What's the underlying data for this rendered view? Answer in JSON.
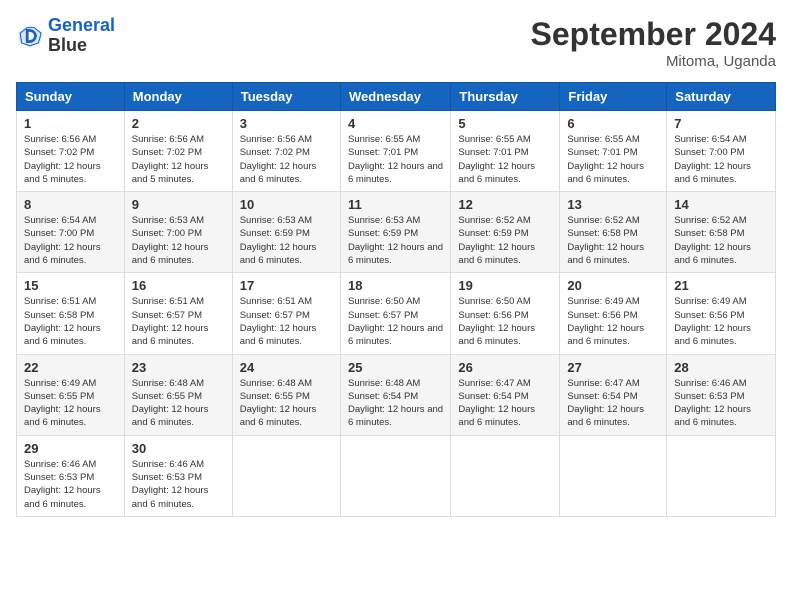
{
  "logo": {
    "line1": "General",
    "line2": "Blue"
  },
  "title": "September 2024",
  "location": "Mitoma, Uganda",
  "headers": [
    "Sunday",
    "Monday",
    "Tuesday",
    "Wednesday",
    "Thursday",
    "Friday",
    "Saturday"
  ],
  "weeks": [
    [
      {
        "day": "1",
        "sunrise": "6:56 AM",
        "sunset": "7:02 PM",
        "daylight": "12 hours and 5 minutes."
      },
      {
        "day": "2",
        "sunrise": "6:56 AM",
        "sunset": "7:02 PM",
        "daylight": "12 hours and 5 minutes."
      },
      {
        "day": "3",
        "sunrise": "6:56 AM",
        "sunset": "7:02 PM",
        "daylight": "12 hours and 6 minutes."
      },
      {
        "day": "4",
        "sunrise": "6:55 AM",
        "sunset": "7:01 PM",
        "daylight": "12 hours and 6 minutes."
      },
      {
        "day": "5",
        "sunrise": "6:55 AM",
        "sunset": "7:01 PM",
        "daylight": "12 hours and 6 minutes."
      },
      {
        "day": "6",
        "sunrise": "6:55 AM",
        "sunset": "7:01 PM",
        "daylight": "12 hours and 6 minutes."
      },
      {
        "day": "7",
        "sunrise": "6:54 AM",
        "sunset": "7:00 PM",
        "daylight": "12 hours and 6 minutes."
      }
    ],
    [
      {
        "day": "8",
        "sunrise": "6:54 AM",
        "sunset": "7:00 PM",
        "daylight": "12 hours and 6 minutes."
      },
      {
        "day": "9",
        "sunrise": "6:53 AM",
        "sunset": "7:00 PM",
        "daylight": "12 hours and 6 minutes."
      },
      {
        "day": "10",
        "sunrise": "6:53 AM",
        "sunset": "6:59 PM",
        "daylight": "12 hours and 6 minutes."
      },
      {
        "day": "11",
        "sunrise": "6:53 AM",
        "sunset": "6:59 PM",
        "daylight": "12 hours and 6 minutes."
      },
      {
        "day": "12",
        "sunrise": "6:52 AM",
        "sunset": "6:59 PM",
        "daylight": "12 hours and 6 minutes."
      },
      {
        "day": "13",
        "sunrise": "6:52 AM",
        "sunset": "6:58 PM",
        "daylight": "12 hours and 6 minutes."
      },
      {
        "day": "14",
        "sunrise": "6:52 AM",
        "sunset": "6:58 PM",
        "daylight": "12 hours and 6 minutes."
      }
    ],
    [
      {
        "day": "15",
        "sunrise": "6:51 AM",
        "sunset": "6:58 PM",
        "daylight": "12 hours and 6 minutes."
      },
      {
        "day": "16",
        "sunrise": "6:51 AM",
        "sunset": "6:57 PM",
        "daylight": "12 hours and 6 minutes."
      },
      {
        "day": "17",
        "sunrise": "6:51 AM",
        "sunset": "6:57 PM",
        "daylight": "12 hours and 6 minutes."
      },
      {
        "day": "18",
        "sunrise": "6:50 AM",
        "sunset": "6:57 PM",
        "daylight": "12 hours and 6 minutes."
      },
      {
        "day": "19",
        "sunrise": "6:50 AM",
        "sunset": "6:56 PM",
        "daylight": "12 hours and 6 minutes."
      },
      {
        "day": "20",
        "sunrise": "6:49 AM",
        "sunset": "6:56 PM",
        "daylight": "12 hours and 6 minutes."
      },
      {
        "day": "21",
        "sunrise": "6:49 AM",
        "sunset": "6:56 PM",
        "daylight": "12 hours and 6 minutes."
      }
    ],
    [
      {
        "day": "22",
        "sunrise": "6:49 AM",
        "sunset": "6:55 PM",
        "daylight": "12 hours and 6 minutes."
      },
      {
        "day": "23",
        "sunrise": "6:48 AM",
        "sunset": "6:55 PM",
        "daylight": "12 hours and 6 minutes."
      },
      {
        "day": "24",
        "sunrise": "6:48 AM",
        "sunset": "6:55 PM",
        "daylight": "12 hours and 6 minutes."
      },
      {
        "day": "25",
        "sunrise": "6:48 AM",
        "sunset": "6:54 PM",
        "daylight": "12 hours and 6 minutes."
      },
      {
        "day": "26",
        "sunrise": "6:47 AM",
        "sunset": "6:54 PM",
        "daylight": "12 hours and 6 minutes."
      },
      {
        "day": "27",
        "sunrise": "6:47 AM",
        "sunset": "6:54 PM",
        "daylight": "12 hours and 6 minutes."
      },
      {
        "day": "28",
        "sunrise": "6:46 AM",
        "sunset": "6:53 PM",
        "daylight": "12 hours and 6 minutes."
      }
    ],
    [
      {
        "day": "29",
        "sunrise": "6:46 AM",
        "sunset": "6:53 PM",
        "daylight": "12 hours and 6 minutes."
      },
      {
        "day": "30",
        "sunrise": "6:46 AM",
        "sunset": "6:53 PM",
        "daylight": "12 hours and 6 minutes."
      },
      null,
      null,
      null,
      null,
      null
    ]
  ]
}
